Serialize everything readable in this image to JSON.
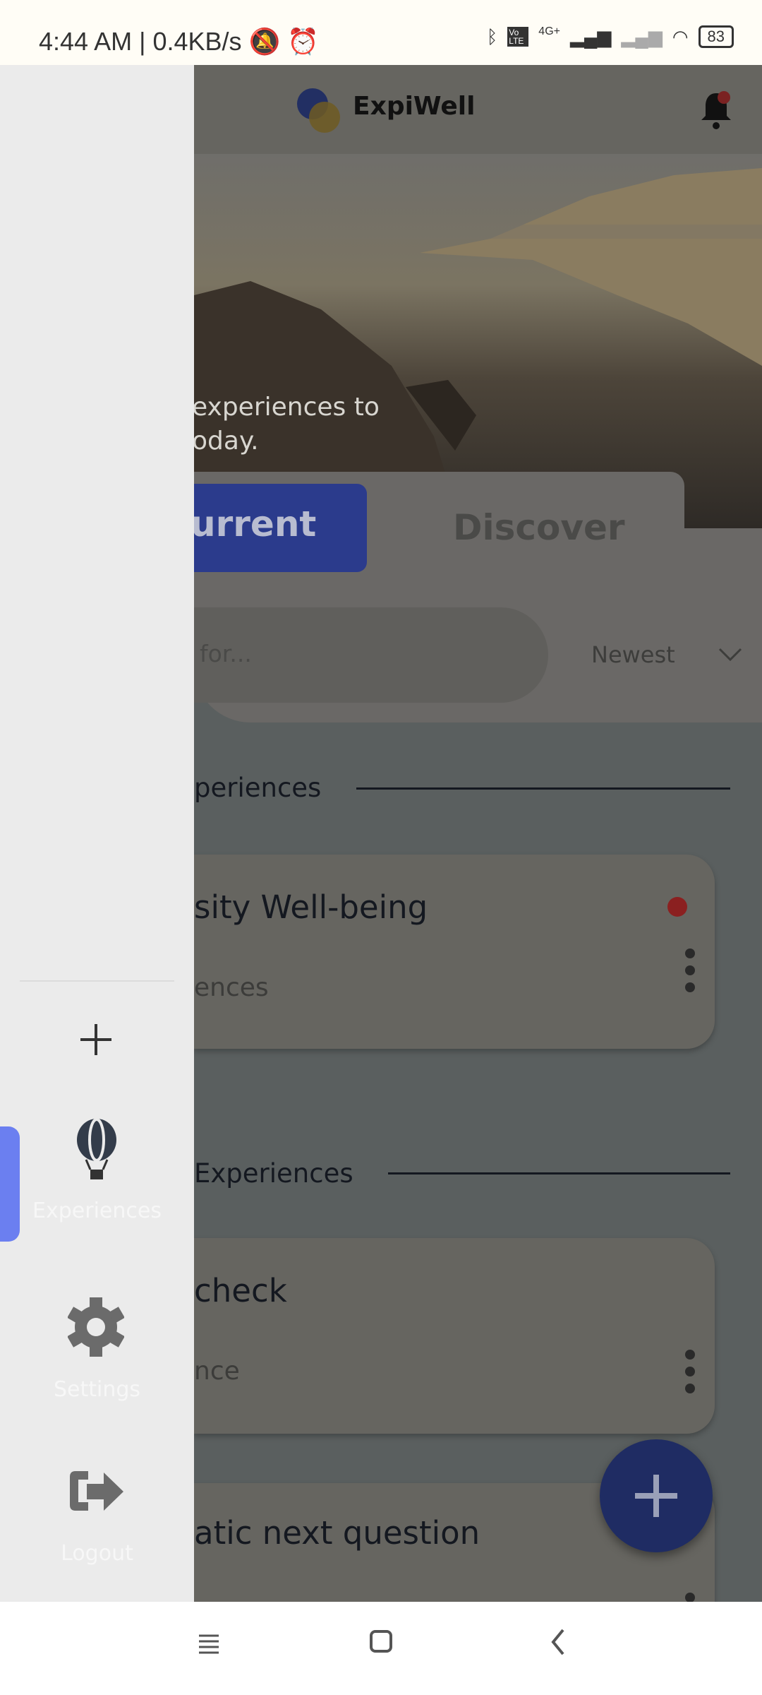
{
  "status_bar": {
    "time": "4:44 AM",
    "net_speed": "| 0.4KB/s",
    "network": "4G+",
    "volte": "Vo LTE",
    "battery": "83",
    "icons": [
      "mute-icon",
      "alarm-icon",
      "bluetooth-icon",
      "signal-icon",
      "wifi-icon",
      "battery-icon"
    ]
  },
  "header": {
    "brand": "ExpiWell",
    "icons": [
      "logo-icon",
      "notification-bell-icon"
    ]
  },
  "hero": {
    "line1": "experiences to",
    "line2": "oday."
  },
  "tabs": {
    "current": "urrent",
    "discover": "Discover"
  },
  "search": {
    "placeholder": "for...",
    "sort": "Newest"
  },
  "sections": [
    {
      "title": "periences",
      "cards": [
        {
          "title": "sity Well-being",
          "subtitle": "ences",
          "unread": true
        }
      ]
    },
    {
      "title": "Experiences",
      "cards": [
        {
          "title": "check",
          "subtitle": "nce"
        },
        {
          "title": "atic next question",
          "subtitle": ""
        }
      ]
    }
  ],
  "drawer": {
    "items": [
      {
        "label": "",
        "icon": "plus-icon"
      },
      {
        "label": "Experiences",
        "icon": "balloon-icon",
        "active": true
      },
      {
        "label": "Settings",
        "icon": "gear-icon"
      },
      {
        "label": "Logout",
        "icon": "logout-icon"
      }
    ]
  },
  "colors": {
    "accent": "#6b7ff0",
    "fab": "#2f44b0",
    "unread": "#d32f2f"
  }
}
